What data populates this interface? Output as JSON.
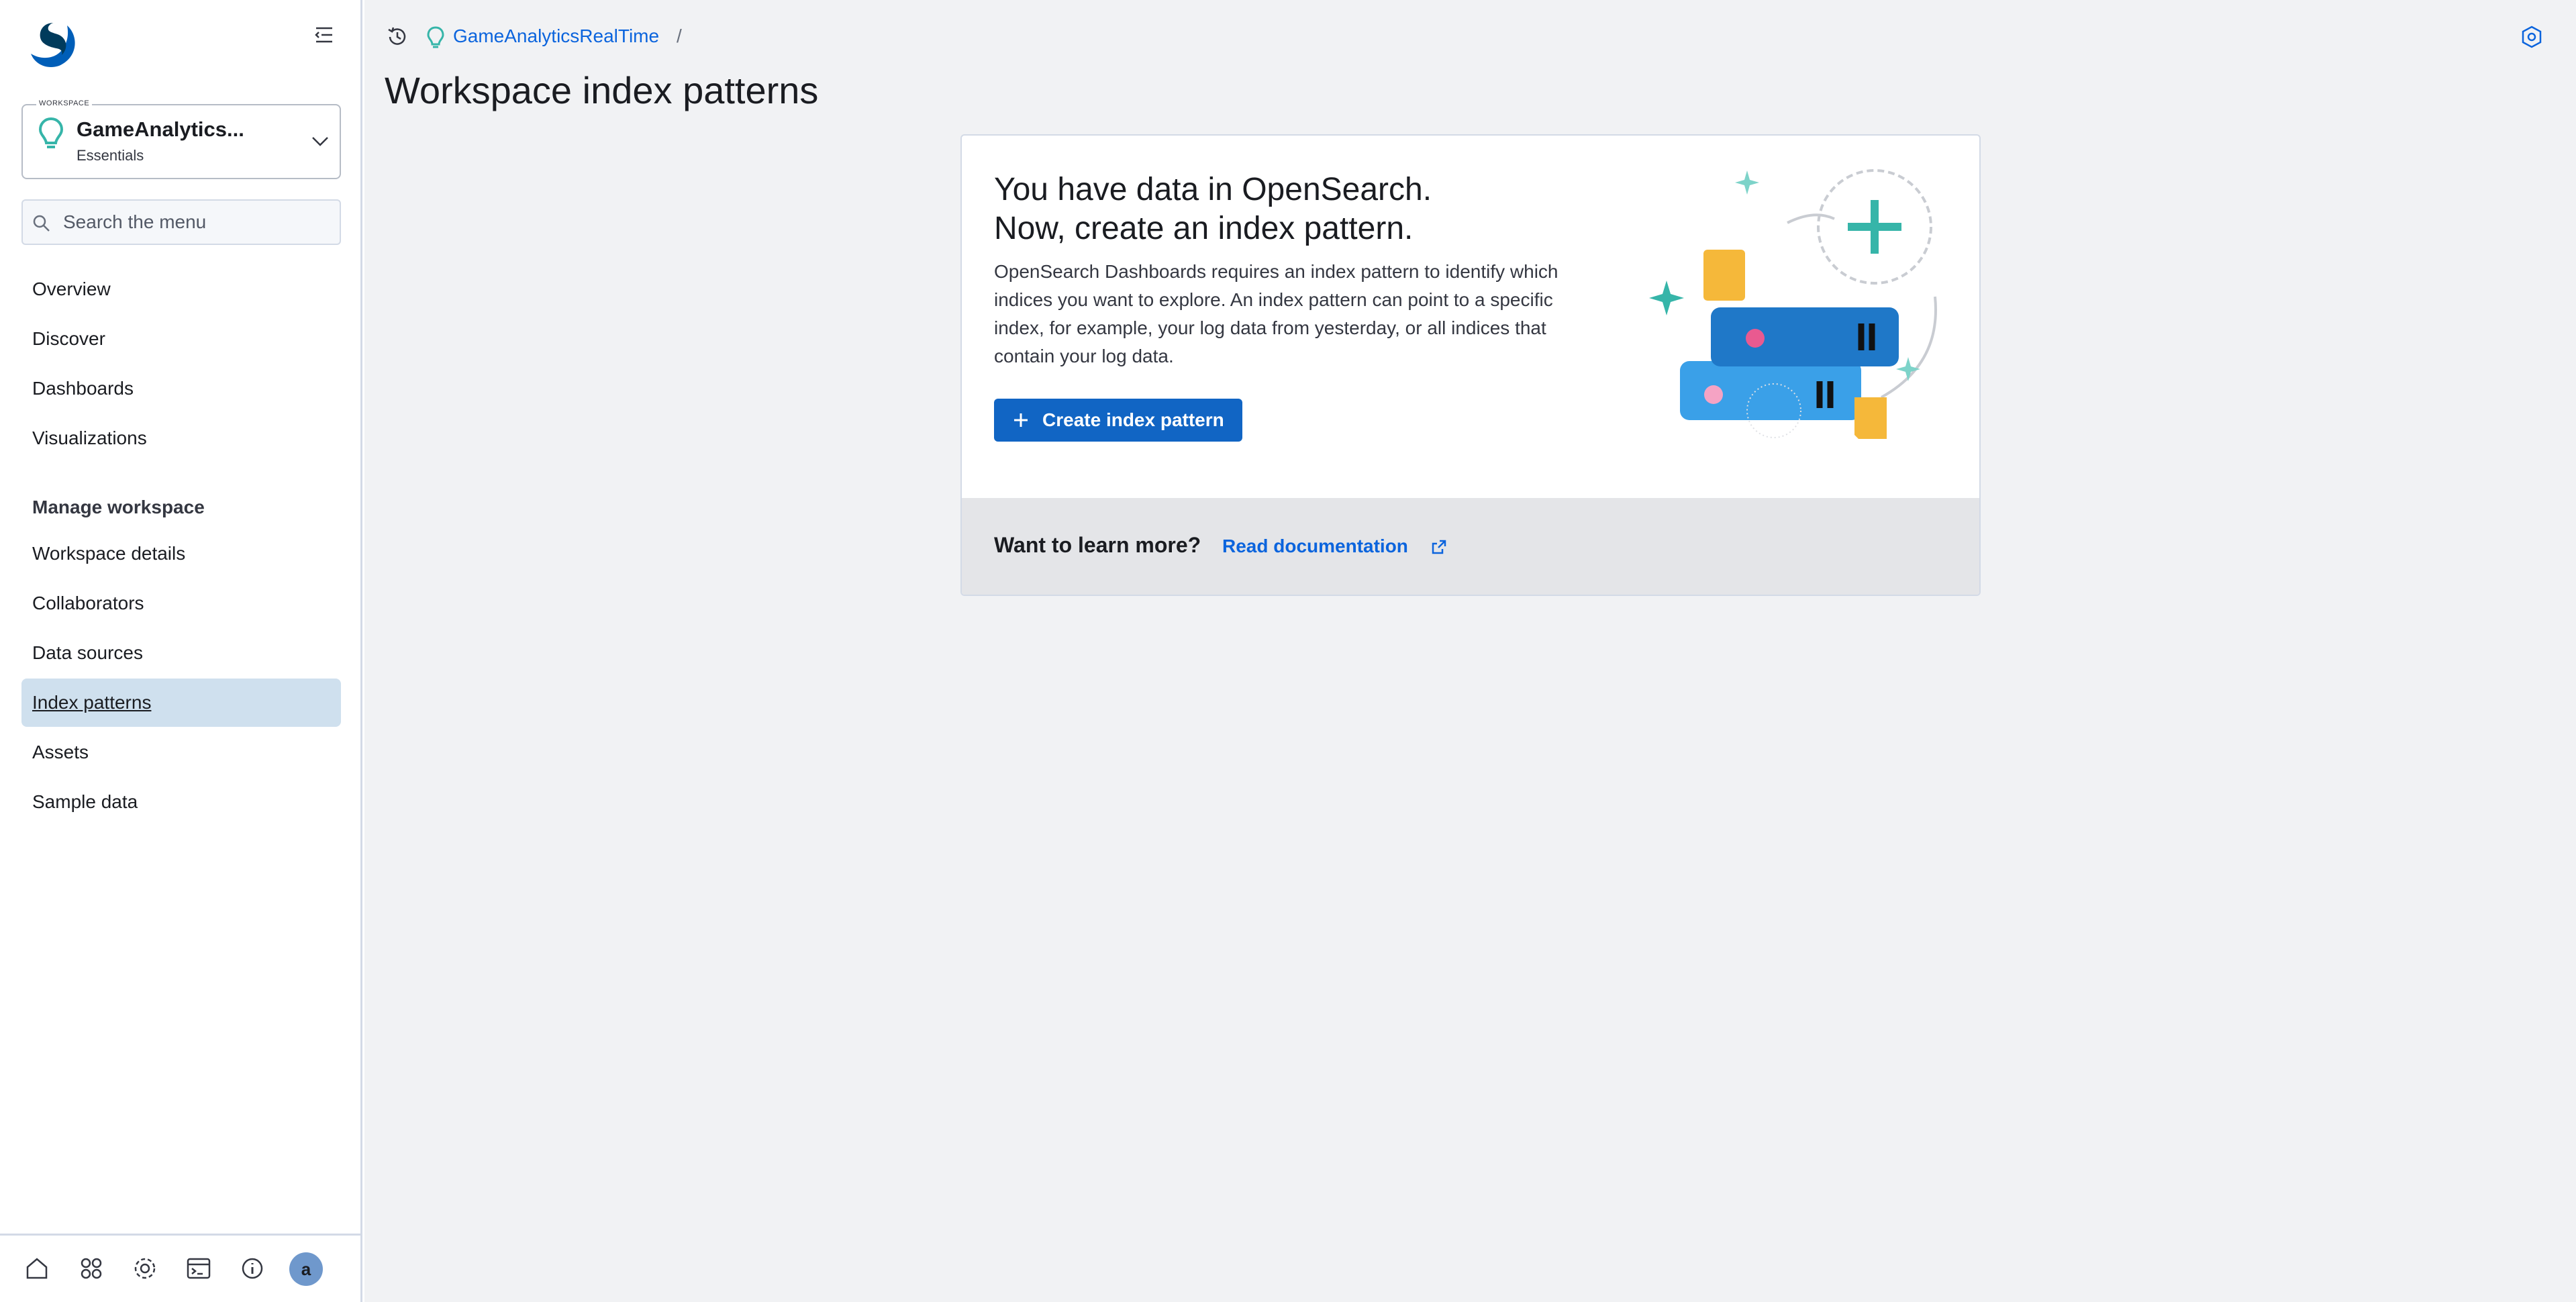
{
  "sidebar": {
    "workspace": {
      "tag": "WORKSPACE",
      "name": "GameAnalytics...",
      "subtitle": "Essentials"
    },
    "search": {
      "placeholder": "Search the menu"
    },
    "nav_items": [
      {
        "label": "Overview"
      },
      {
        "label": "Discover"
      },
      {
        "label": "Dashboards"
      },
      {
        "label": "Visualizations"
      }
    ],
    "section_title": "Manage workspace",
    "manage_items": [
      {
        "label": "Workspace details"
      },
      {
        "label": "Collaborators"
      },
      {
        "label": "Data sources"
      },
      {
        "label": "Index patterns",
        "active": true
      },
      {
        "label": "Assets"
      },
      {
        "label": "Sample data"
      }
    ],
    "footer": {
      "icons": [
        "home-icon",
        "apps-icon",
        "settings-icon",
        "console-icon",
        "info-icon"
      ],
      "avatar_initial": "a"
    }
  },
  "header": {
    "breadcrumb": {
      "workspace": "GameAnalyticsRealTime",
      "separator": "/"
    },
    "page_title": "Workspace index patterns"
  },
  "panel": {
    "title_line1": "You have data in OpenSearch.",
    "title_line2": "Now, create an index pattern.",
    "description": "OpenSearch Dashboards requires an index pattern to identify which indices you want to explore. An index pattern can point to a specific index, for example, your log data from yesterday, or all indices that contain your log data.",
    "create_button": "Create index pattern",
    "footer_title": "Want to learn more?",
    "footer_link": "Read documentation"
  },
  "colors": {
    "primary": "#1165c4",
    "link": "#0b64dd",
    "active_nav_bg": "#cfe0ee",
    "accent_teal": "#36b5a9"
  }
}
